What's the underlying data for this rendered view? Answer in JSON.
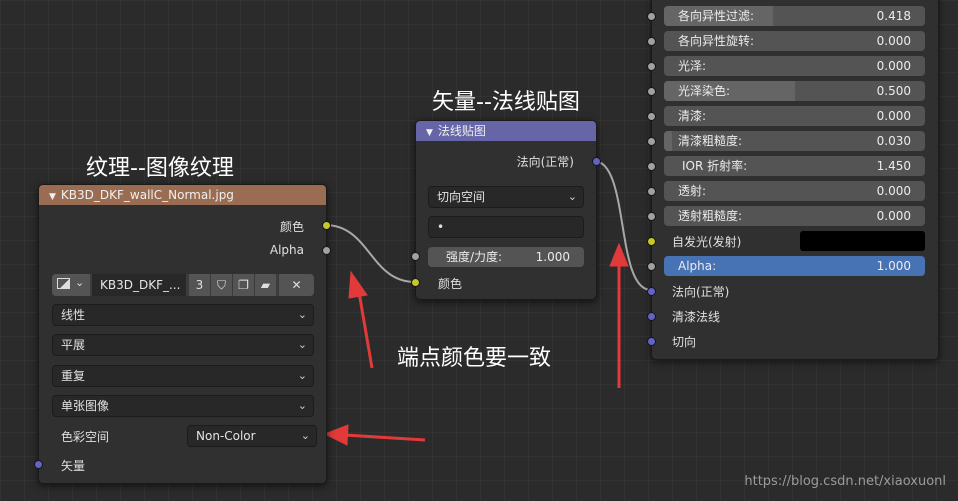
{
  "annotations": {
    "image_texture_title": "纹理--图像纹理",
    "normal_map_title": "矢量--法线贴图",
    "endpoint_note": "端点颜色要一致"
  },
  "image_node": {
    "header": "KB3D_DKF_wallC_Normal.jpg",
    "header_color": "#9a6c52",
    "outputs": [
      "颜色",
      "Alpha"
    ],
    "image_name": "KB3D_DKF_...",
    "user_count": "3",
    "interpolation": "线性",
    "projection": "平展",
    "extension": "重复",
    "source": "单张图像",
    "color_space_label": "色彩空间",
    "color_space_value": "Non-Color",
    "vector_input": "矢量"
  },
  "normal_node": {
    "header": "法线贴图",
    "header_color": "#6565a8",
    "output": "法向(正常)",
    "space": "切向空间",
    "uv_map": "•",
    "strength_label": "强度/力度:",
    "strength_value": "1.000",
    "color_input": "颜色"
  },
  "bsdf_node": {
    "fields": [
      {
        "label": "各向异性过滤:",
        "value": "0.418",
        "fraction": 0.418
      },
      {
        "label": "各向异性旋转:",
        "value": "0.000",
        "fraction": 0.0
      },
      {
        "label": "光泽:",
        "value": "0.000",
        "fraction": 0.0
      },
      {
        "label": "光泽染色:",
        "value": "0.500",
        "fraction": 0.5
      },
      {
        "label": "清漆:",
        "value": "0.000",
        "fraction": 0.0
      },
      {
        "label": "清漆粗糙度:",
        "value": "0.030",
        "fraction": 0.03
      },
      {
        "label": "IOR 折射率:",
        "value": "1.450",
        "fraction": 0.0
      },
      {
        "label": "透射:",
        "value": "0.000",
        "fraction": 0.0
      },
      {
        "label": "透射粗糙度:",
        "value": "0.000",
        "fraction": 0.0
      }
    ],
    "emission_label": "自发光(发射)",
    "emission_color": "#000000",
    "alpha_label": "Alpha:",
    "alpha_value": "1.000",
    "normal_input": "法向(正常)",
    "clearcoat_normal": "清漆法线",
    "tangent": "切向"
  },
  "colors": {
    "highlight_red": "#e23a3a",
    "link": "#9a9a9a"
  },
  "watermark": "https://blog.csdn.net/xiaoxuonl"
}
